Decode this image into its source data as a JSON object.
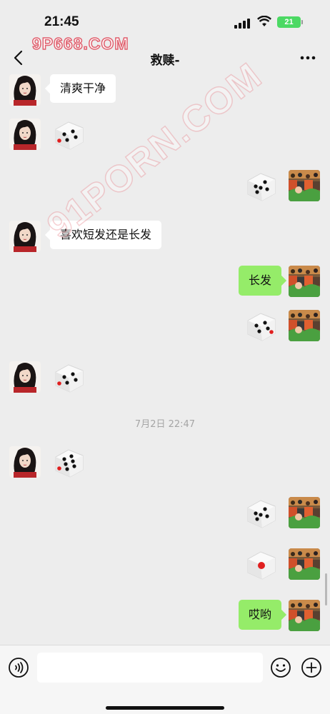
{
  "status_bar": {
    "time": "21:45",
    "battery": "21"
  },
  "watermark": {
    "top": "9P668.COM",
    "diagonal": "91PORN.COM"
  },
  "nav": {
    "title": "救赎-",
    "back_icon": "chevron-left-icon",
    "more_icon": "ellipsis-icon"
  },
  "messages": [
    {
      "side": "left",
      "type": "text",
      "text": "清爽干净"
    },
    {
      "side": "left",
      "type": "dice",
      "face": 4
    },
    {
      "side": "right",
      "type": "dice",
      "face": 5
    },
    {
      "side": "left",
      "type": "text",
      "text": "喜欢短发还是长发"
    },
    {
      "side": "right",
      "type": "text",
      "text": "长发"
    },
    {
      "side": "right",
      "type": "dice",
      "face": 4
    },
    {
      "side": "left",
      "type": "dice",
      "face": 4
    },
    {
      "side": "left",
      "type": "dice",
      "face": 6
    },
    {
      "side": "right",
      "type": "dice",
      "face": 5
    },
    {
      "side": "right",
      "type": "dice",
      "face": 1
    },
    {
      "side": "right",
      "type": "text",
      "text": "哎哟"
    }
  ],
  "timestamp": "7月2日 22:47",
  "input_bar": {
    "placeholder": "",
    "voice_icon": "voice-icon",
    "emoji_icon": "emoji-icon",
    "plus_icon": "plus-icon"
  },
  "colors": {
    "background": "#ededed",
    "sent_bubble": "#95ec69",
    "received_bubble": "#ffffff",
    "pip_red": "#e01f1f"
  }
}
